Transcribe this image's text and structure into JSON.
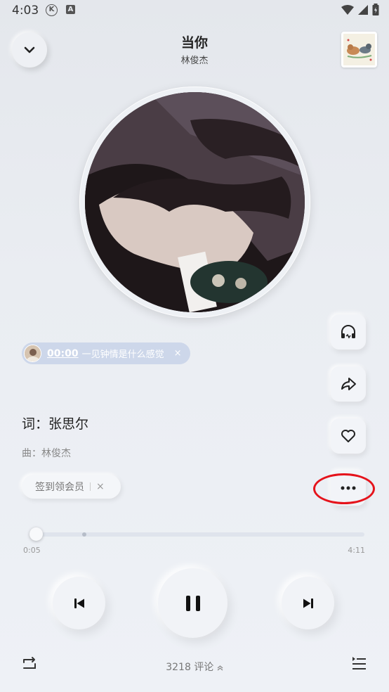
{
  "status_bar": {
    "time": "4:03",
    "k_badge": "K",
    "a_badge": "A",
    "icons": [
      "wifi-icon",
      "signal-icon",
      "battery-icon"
    ]
  },
  "header": {
    "title": "当你",
    "artist": "林俊杰",
    "back_icon": "chevron-down-icon"
  },
  "side_actions": [
    "headphones-icon",
    "share-icon",
    "heart-icon",
    "more-icon"
  ],
  "floating_comment": {
    "time": "00:00",
    "text": "一见钟情是什么感觉",
    "close": "×"
  },
  "lyrics": {
    "line1": "词：张思尔",
    "line2": "曲：林俊杰"
  },
  "vip_pill": {
    "label": "签到领会员",
    "close": "×"
  },
  "progress": {
    "current": "0:05",
    "total": "4:11",
    "fraction": 0.02
  },
  "controls": {
    "prev_icon": "skip-previous-icon",
    "play_icon": "pause-icon",
    "next_icon": "skip-next-icon"
  },
  "bottom_bar": {
    "repeat_icon": "repeat-icon",
    "comment_count": "3218",
    "comment_label": "评论",
    "playlist_icon": "playlist-icon"
  },
  "colors": {
    "accent_highlight": "#e5131b",
    "comment_pill": "#cdd7ea"
  }
}
